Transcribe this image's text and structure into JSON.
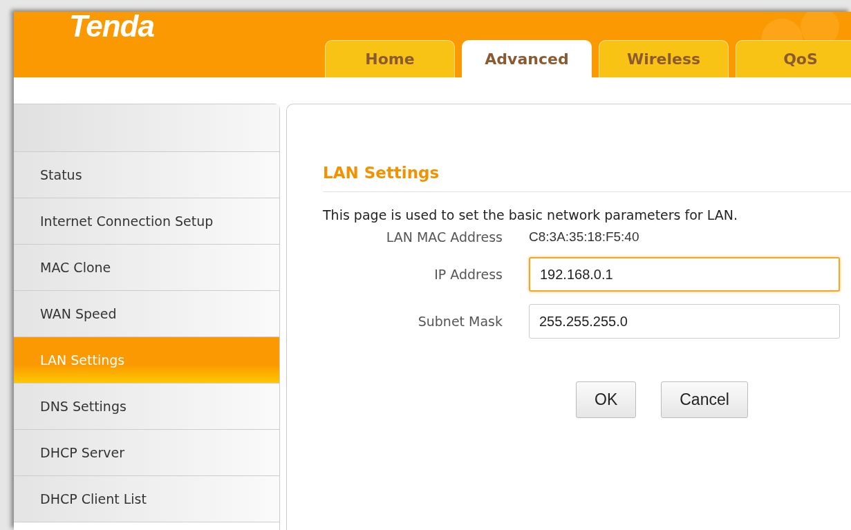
{
  "logo": "Tenda",
  "tabs": [
    {
      "label": "Home",
      "selected": false
    },
    {
      "label": "Advanced",
      "selected": true
    },
    {
      "label": "Wireless",
      "selected": false
    },
    {
      "label": "QoS",
      "selected": false
    }
  ],
  "sidebar": {
    "items": [
      {
        "label": "Status",
        "selected": false
      },
      {
        "label": "Internet Connection Setup",
        "selected": false
      },
      {
        "label": "MAC Clone",
        "selected": false
      },
      {
        "label": "WAN Speed",
        "selected": false
      },
      {
        "label": "LAN Settings",
        "selected": true
      },
      {
        "label": "DNS Settings",
        "selected": false
      },
      {
        "label": "DHCP Server",
        "selected": false
      },
      {
        "label": "DHCP Client List",
        "selected": false
      }
    ]
  },
  "content": {
    "title": "LAN Settings",
    "description": "This page is used to set the basic network parameters for LAN.",
    "fields": [
      {
        "kind": "text",
        "label": "LAN MAC Address",
        "value": "C8:3A:35:18:F5:40"
      },
      {
        "kind": "input",
        "label": "IP Address",
        "value": "192.168.0.1",
        "focused": true
      },
      {
        "kind": "input",
        "label": "Subnet Mask",
        "value": "255.255.255.0",
        "focused": false
      }
    ],
    "buttons": [
      "OK",
      "Cancel"
    ]
  }
}
